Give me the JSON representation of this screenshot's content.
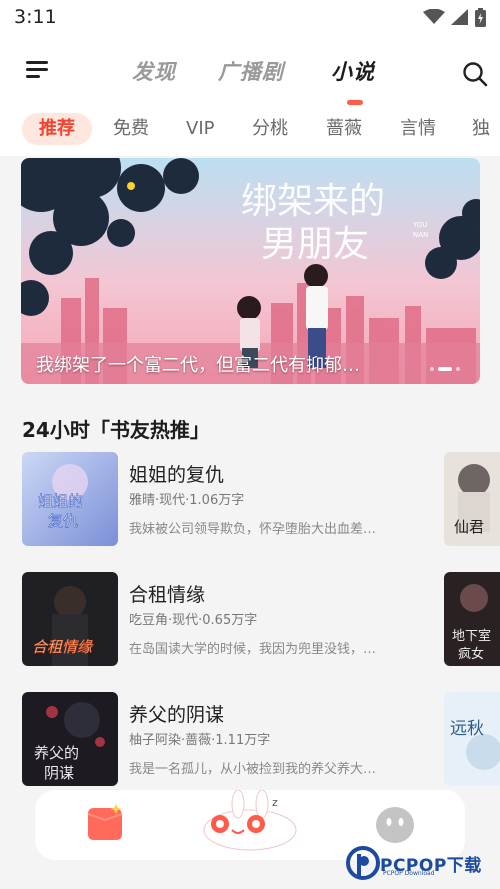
{
  "status_bar": {
    "time": "3:11",
    "icons": [
      "wifi-icon",
      "signal-icon",
      "battery-icon"
    ]
  },
  "nav": {
    "tabs": [
      {
        "label": "发现",
        "active": false
      },
      {
        "label": "广播剧",
        "active": false
      },
      {
        "label": "小说",
        "active": true
      }
    ],
    "menu_icon": "menu-icon",
    "search_icon": "search-icon"
  },
  "categories": [
    "推荐",
    "免费",
    "VIP",
    "分桃",
    "蔷薇",
    "言情",
    "独"
  ],
  "banner": {
    "art_title": "绑架来的男朋友",
    "art_subtitle": "YOU NAN",
    "caption": "我绑架了一个富二代，但富二代有抑郁…"
  },
  "section": {
    "title": "24小时「书友热推」"
  },
  "books": [
    {
      "title": "姐姐的复仇",
      "meta": "雅晴·现代·1.06万字",
      "desc": "我妹被公司领导欺负，怀孕堕胎大出血差…",
      "cover_text": "姐姐的复仇"
    },
    {
      "title": "合租情缘",
      "meta": "吃豆角·现代·0.65万字",
      "desc": "在岛国读大学的时候，我因为兜里没钱，…",
      "cover_text": "合租情缘"
    },
    {
      "title": "养父的阴谋",
      "meta": "柚子阿染·蔷薇·1.11万字",
      "desc": "我是一名孤儿，从小被捡到我的养父养大…",
      "cover_text": "养父的阴谋"
    }
  ],
  "side_covers": [
    {
      "text": "仙君"
    },
    {
      "text": "地下室疯女"
    },
    {
      "text": "远秋"
    }
  ],
  "bottom_nav": {
    "items": [
      "book-icon",
      "mascot-icon",
      "profile-icon"
    ]
  },
  "watermark": {
    "brand": "PCPOP下载",
    "sub": "PCPOP Download"
  },
  "colors": {
    "accent": "#f2452f",
    "accent_bg": "#ffe6df",
    "indicator": "#ff5b45"
  }
}
